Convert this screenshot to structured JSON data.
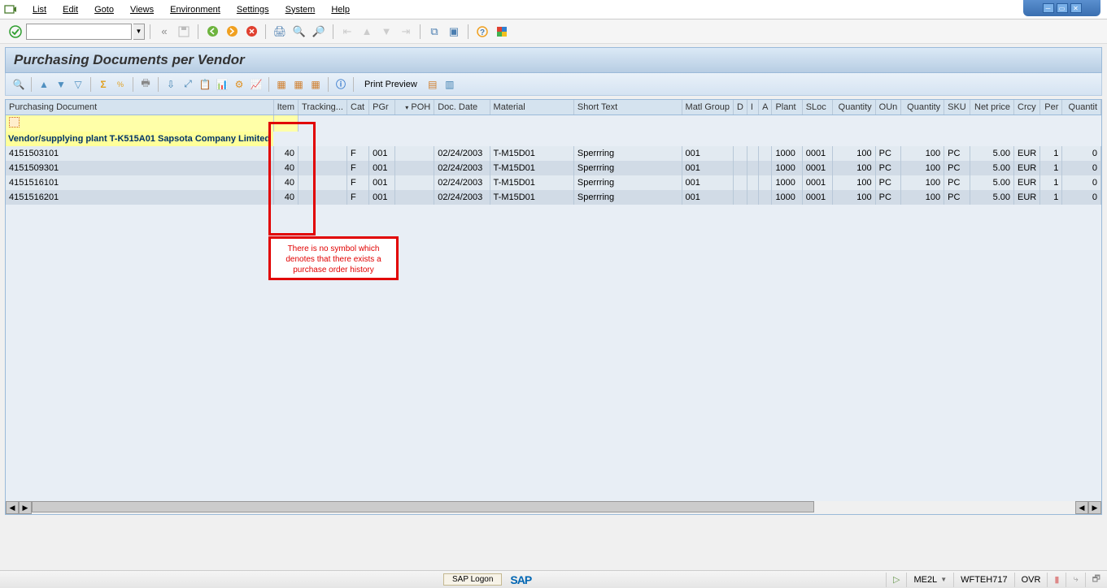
{
  "menu": [
    "List",
    "Edit",
    "Goto",
    "Views",
    "Environment",
    "Settings",
    "System",
    "Help"
  ],
  "title": "Purchasing Documents per Vendor",
  "toolbar2_text": "Print Preview",
  "columns": [
    "Purchasing Document",
    "Item",
    "Tracking...",
    "Cat",
    "PGr",
    "POH",
    "Doc. Date",
    "Material",
    "Short Text",
    "Matl Group",
    "D",
    "I",
    "A",
    "Plant",
    "SLoc",
    "Quantity",
    "OUn",
    "Quantity",
    "SKU",
    "Net price",
    "Crcy",
    "Per",
    "Quantit"
  ],
  "group_row": "Vendor/supplying plant T-K515A01  Sapsota Company Limited",
  "rows": [
    {
      "doc": "4151503101",
      "item": "40",
      "trk": "",
      "cat": "F",
      "pgr": "001",
      "poh": "",
      "date": "02/24/2003",
      "mat": "T-M15D01",
      "text": "Sperrring",
      "grp": "001",
      "d": "",
      "i": "",
      "a": "",
      "plant": "1000",
      "sloc": "0001",
      "qty1": "100",
      "oun": "PC",
      "qty2": "100",
      "sku": "PC",
      "price": "5.00",
      "crcy": "EUR",
      "per": "1",
      "qty3": "0"
    },
    {
      "doc": "4151509301",
      "item": "40",
      "trk": "",
      "cat": "F",
      "pgr": "001",
      "poh": "",
      "date": "02/24/2003",
      "mat": "T-M15D01",
      "text": "Sperrring",
      "grp": "001",
      "d": "",
      "i": "",
      "a": "",
      "plant": "1000",
      "sloc": "0001",
      "qty1": "100",
      "oun": "PC",
      "qty2": "100",
      "sku": "PC",
      "price": "5.00",
      "crcy": "EUR",
      "per": "1",
      "qty3": "0"
    },
    {
      "doc": "4151516101",
      "item": "40",
      "trk": "",
      "cat": "F",
      "pgr": "001",
      "poh": "",
      "date": "02/24/2003",
      "mat": "T-M15D01",
      "text": "Sperrring",
      "grp": "001",
      "d": "",
      "i": "",
      "a": "",
      "plant": "1000",
      "sloc": "0001",
      "qty1": "100",
      "oun": "PC",
      "qty2": "100",
      "sku": "PC",
      "price": "5.00",
      "crcy": "EUR",
      "per": "1",
      "qty3": "0"
    },
    {
      "doc": "4151516201",
      "item": "40",
      "trk": "",
      "cat": "F",
      "pgr": "001",
      "poh": "",
      "date": "02/24/2003",
      "mat": "T-M15D01",
      "text": "Sperrring",
      "grp": "001",
      "d": "",
      "i": "",
      "a": "",
      "plant": "1000",
      "sloc": "0001",
      "qty1": "100",
      "oun": "PC",
      "qty2": "100",
      "sku": "PC",
      "price": "5.00",
      "crcy": "EUR",
      "per": "1",
      "qty3": "0"
    }
  ],
  "annotation": "There is no symbol which denotes that there exists a purchase order history",
  "status": {
    "sap_logon": "SAP Logon",
    "logo": "SAP",
    "tcode": "ME2L",
    "server": "WFTEH717",
    "mode": "OVR"
  }
}
